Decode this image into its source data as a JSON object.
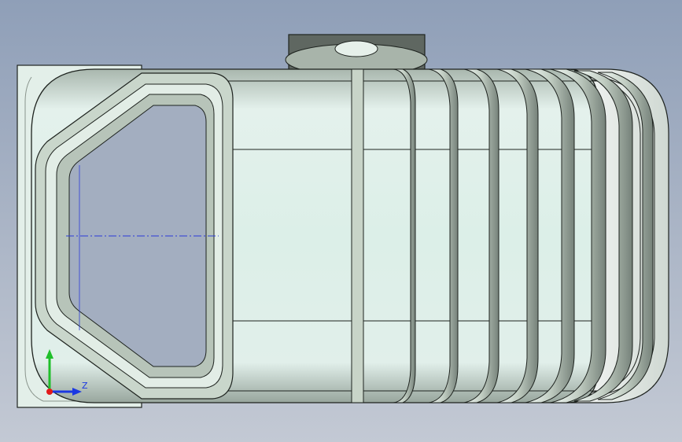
{
  "scene": {
    "description_free": true,
    "colors": {
      "background_top": "#8f9fb8",
      "background_bottom": "#c3c9d4",
      "body_fill": "#dfeee8",
      "body_shadow": "#b9c7bf",
      "rib_fill": "#c8d4c8",
      "rib_dark": "#6f7a70",
      "edge": "#1e231f",
      "flange_fill": "#e3efe9",
      "cap_fill": "#5f6761",
      "centerline": "#2b3bd8"
    },
    "rib_count": 9
  },
  "triad": {
    "x_axis_label": "",
    "y_axis_label": "",
    "z_axis_label": "Z",
    "colors": {
      "x": "#e21b1b",
      "y": "#1fbf2a",
      "z": "#1b38e2"
    }
  }
}
